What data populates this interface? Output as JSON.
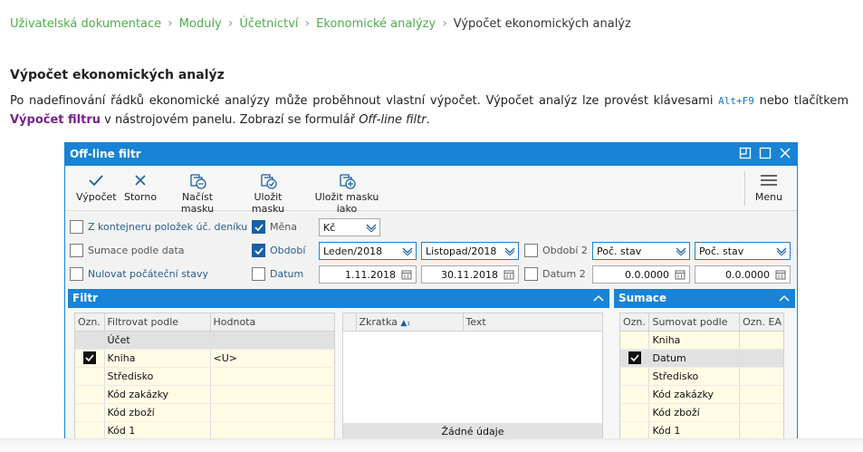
{
  "breadcrumb": {
    "items": [
      "Uživatelská dokumentace",
      "Moduly",
      "Účetnictví",
      "Ekonomické analýzy"
    ],
    "current": "Výpočet ekonomických analýz",
    "separator": "›"
  },
  "article": {
    "heading": "Výpočet ekonomických analýz",
    "p_part1": "Po nadefinování řádků ekonomické analýzy může proběhnout vlastní výpočet. Výpočet analýz lze provést klávesami ",
    "shortcut": "Alt+F9",
    "p_part2": " nebo tlačítkem ",
    "button_ref": "Výpočet filtru",
    "p_part3": " v nástrojovém panelu. Zobrazí se formulář ",
    "form_ref": "Off-line filtr",
    "p_part4": "."
  },
  "dialog": {
    "title": "Off-line filtr",
    "toolbar": {
      "calc": "Výpočet",
      "cancel": "Storno",
      "load_mask": "Načíst masku",
      "save_mask": "Uložit masku",
      "save_mask_as": "Uložit masku jako",
      "menu": "Menu"
    },
    "params": {
      "from_container": "Z kontejneru položek úč. deníku",
      "sum_by_date": "Sumace podle data",
      "reset_initial": "Nulovat počáteční stavy",
      "currency_label": "Měna",
      "currency_value": "Kč",
      "period_label": "Období",
      "period_from": "Leden/2018",
      "period_to": "Listopad/2018",
      "date_label": "Datum",
      "date_from": "1.11.2018",
      "date_to": "30.11.2018",
      "period2_label": "Období 2",
      "period2_from": "Poč. stav",
      "period2_to": "Poč. stav",
      "date2_label": "Datum 2",
      "date2_from": "0.0.0000",
      "date2_to": "0.0.0000"
    },
    "filter_panel": {
      "title": "Filtr",
      "columns": [
        "Ozn.",
        "Filtrovat podle",
        "Hodnota"
      ],
      "rows": [
        {
          "mark": false,
          "name": "Účet",
          "value": "",
          "selected": true
        },
        {
          "mark": true,
          "name": "Kniha",
          "value": "<U>",
          "selected": false
        },
        {
          "mark": false,
          "name": "Středisko",
          "value": "",
          "selected": false
        },
        {
          "mark": false,
          "name": "Kód zakázky",
          "value": "",
          "selected": false
        },
        {
          "mark": false,
          "name": "Kód zboží",
          "value": "",
          "selected": false
        },
        {
          "mark": false,
          "name": "Kód 1",
          "value": "",
          "selected": false
        }
      ],
      "detail_columns": [
        "Zkratka",
        "Text"
      ],
      "empty_text": "Žádné údaje"
    },
    "sum_panel": {
      "title": "Sumace",
      "columns": [
        "Ozn.",
        "Sumovat podle",
        "Ozn. EA"
      ],
      "rows": [
        {
          "mark": false,
          "name": "Kniha",
          "selected": false
        },
        {
          "mark": true,
          "name": "Datum",
          "selected": true
        },
        {
          "mark": false,
          "name": "Středisko",
          "selected": false
        },
        {
          "mark": false,
          "name": "Kód zakázky",
          "selected": false
        },
        {
          "mark": false,
          "name": "Kód zboží",
          "selected": false
        },
        {
          "mark": false,
          "name": "Kód 1",
          "selected": false
        }
      ]
    }
  },
  "colors": {
    "accent": "#1883d7",
    "link_green": "#4cae4c",
    "shortcut_blue": "#1a73c8",
    "button_ref_purple": "#7b2090"
  }
}
